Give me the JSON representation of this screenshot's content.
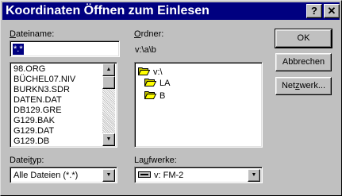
{
  "window": {
    "title": "Koordinaten Öffnen zum Einlesen",
    "help_label": "?",
    "close_label": "✕"
  },
  "file_name": {
    "label_underlined": "D",
    "label_rest": "ateiname:",
    "value": "*.*"
  },
  "files": [
    "98.ORG",
    "BÜCHEL07.NIV",
    "BURKN3.SDR",
    "DATEN.DAT",
    "DB129.GRE",
    "G129.BAK",
    "G129.DAT",
    "G129.DB"
  ],
  "folders": {
    "label_underlined": "O",
    "label_rest": "rdner:",
    "current_path": "v:\\a\\b",
    "tree": [
      "v:\\",
      "LA",
      "B"
    ]
  },
  "file_type": {
    "label_pre": "Datei",
    "label_underlined": "t",
    "label_rest": "yp:",
    "value": "Alle Dateien (*.*)"
  },
  "drives": {
    "label_pre": "La",
    "label_underlined": "u",
    "label_rest": "fwerke:",
    "value": "v: FM-2"
  },
  "buttons": {
    "ok": "OK",
    "cancel": "Abbrechen",
    "network_pre": "Net",
    "network_underlined": "z",
    "network_rest": "werk..."
  },
  "scroll": {
    "up_icon": "arrow-up-icon",
    "down_icon": "arrow-down-icon",
    "arrow_up": "▲",
    "arrow_down": "▼"
  },
  "colors": {
    "title_bar": "#000080",
    "dialog_face": "#c0c0c0",
    "selection": "#000080",
    "folder": "#ffff00"
  }
}
